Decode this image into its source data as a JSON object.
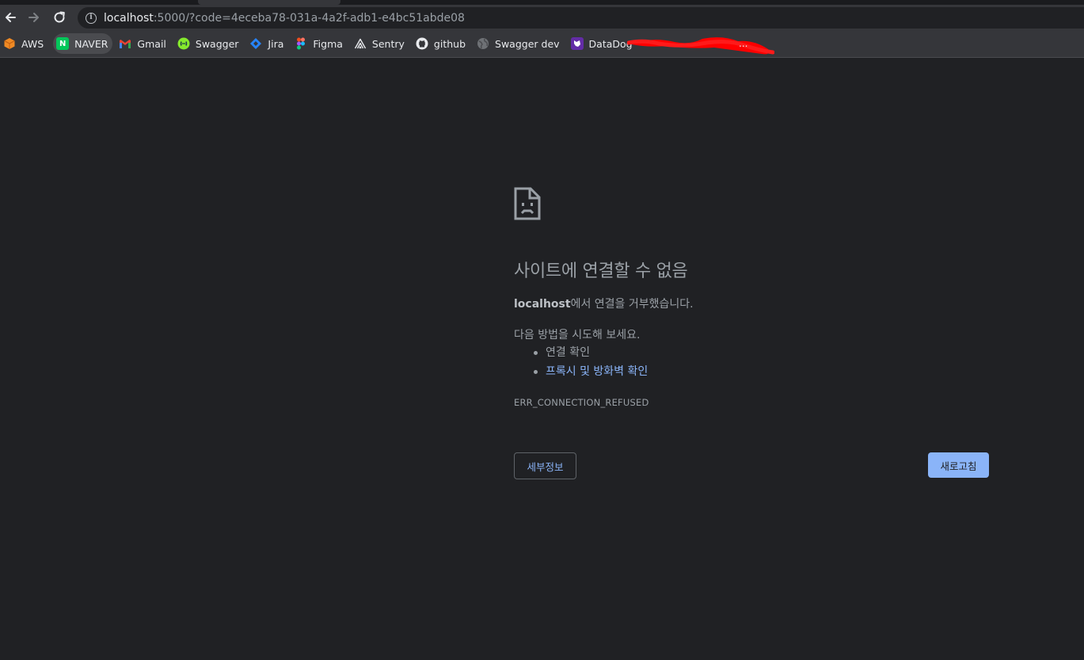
{
  "browser": {
    "url_host": "localhost",
    "url_rest": ":5000/?code=4eceba78-031a-4a2f-adb1-e4bc51abde08",
    "bookmarks": [
      {
        "label": "AWS",
        "icon": "aws-cube-icon"
      },
      {
        "label": "NAVER",
        "icon": "naver-n-icon"
      },
      {
        "label": "Gmail",
        "icon": "gmail-m-icon"
      },
      {
        "label": "Swagger",
        "icon": "swagger-icon"
      },
      {
        "label": "Jira",
        "icon": "jira-icon"
      },
      {
        "label": "Figma",
        "icon": "figma-icon"
      },
      {
        "label": "Sentry",
        "icon": "sentry-icon"
      },
      {
        "label": "github",
        "icon": "github-icon"
      },
      {
        "label": "Swagger dev",
        "icon": "globe-icon"
      },
      {
        "label": "DataDog",
        "icon": "datadog-icon"
      }
    ],
    "bookmarks_overflow": "..."
  },
  "error_page": {
    "title": "사이트에 연결할 수 없음",
    "host": "localhost",
    "desc_suffix": "에서 연결을 거부했습니다.",
    "suggest_lead": "다음 방법을 시도해 보세요.",
    "suggestions": [
      "연결 확인",
      "프록시 및 방화벽 확인"
    ],
    "error_code": "ERR_CONNECTION_REFUSED",
    "details_button": "세부정보",
    "reload_button": "새로고침"
  },
  "colors": {
    "background": "#202124",
    "link": "#8ab4f8",
    "primary_button": "#8ab4f8",
    "redaction": "#ff0000"
  }
}
